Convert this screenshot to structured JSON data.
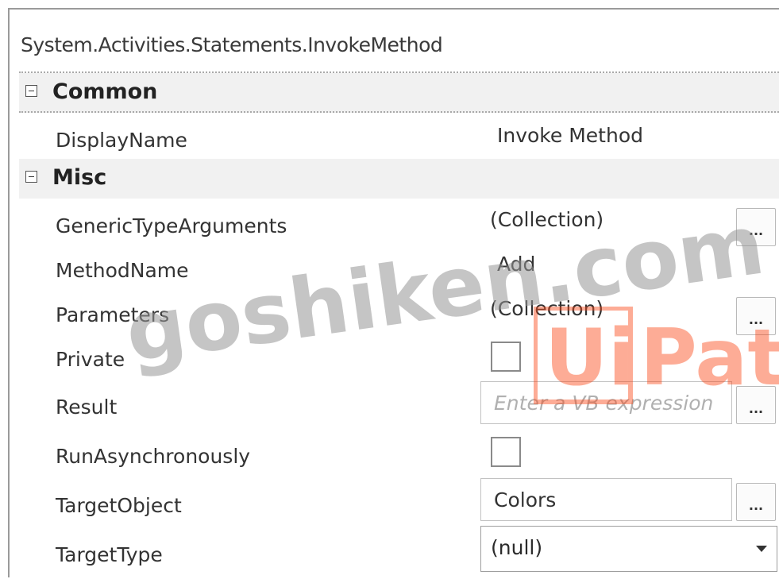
{
  "header": {
    "title": "System.Activities.Statements.InvokeMethod"
  },
  "categories": {
    "common": {
      "label": "Common"
    },
    "misc": {
      "label": "Misc"
    }
  },
  "properties": {
    "display_name": {
      "name": "DisplayName",
      "value": "Invoke Method"
    },
    "generic_type_arguments": {
      "name": "GenericTypeArguments",
      "value": "(Collection)",
      "button": "..."
    },
    "method_name": {
      "name": "MethodName",
      "value": "Add"
    },
    "parameters": {
      "name": "Parameters",
      "value": "(Collection)",
      "button": "..."
    },
    "private": {
      "name": "Private",
      "checked": false
    },
    "result": {
      "name": "Result",
      "placeholder": "Enter a VB expression",
      "button": "..."
    },
    "run_asynchronously": {
      "name": "RunAsynchronously",
      "checked": false
    },
    "target_object": {
      "name": "TargetObject",
      "value": "Colors",
      "button": "..."
    },
    "target_type": {
      "name": "TargetType",
      "value": "(null)"
    }
  },
  "watermark": {
    "text": "goshiken.com",
    "logo_text": "UiPath",
    "logo_color": "#fa4616"
  },
  "colors": {
    "category_bg": "#f1f1f1",
    "border": "#9a9a9a"
  }
}
